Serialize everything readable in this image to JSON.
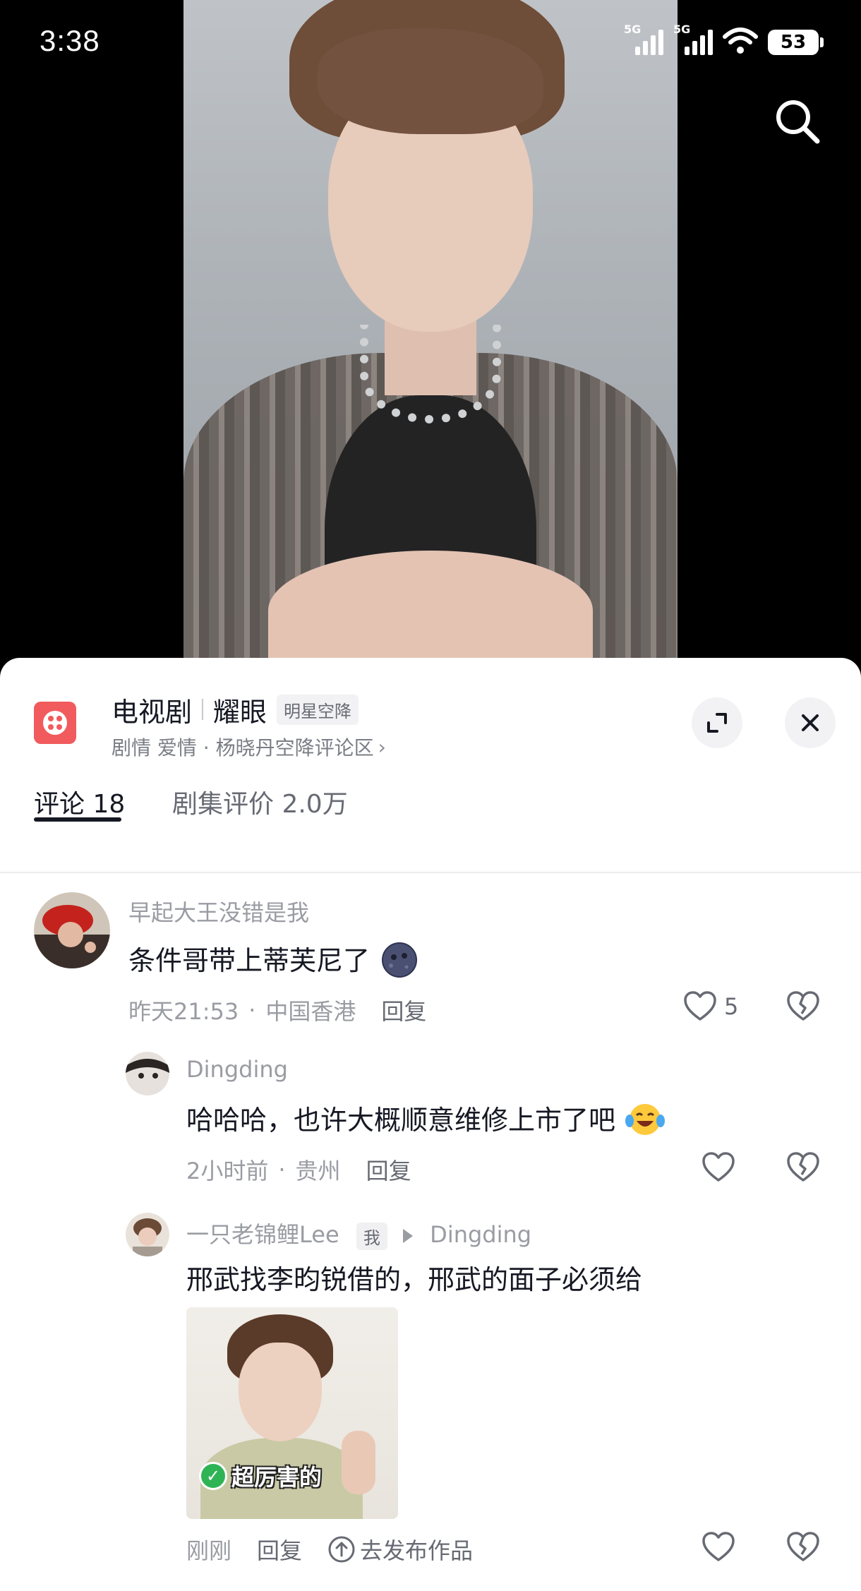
{
  "status_bar": {
    "time": "3:38",
    "signal_1_label": "5G",
    "signal_2_label": "5G",
    "battery": "53"
  },
  "video": {
    "search_icon": "search-icon"
  },
  "sheet_header": {
    "category": "电视剧",
    "show_title": "耀眼",
    "tag": "明星空降",
    "subtitle": "剧情 爱情 · 杨晓丹空降评论区",
    "subtitle_chevron": "›",
    "expand_icon": "expand-icon",
    "close_icon": "close-icon"
  },
  "tabs": [
    {
      "label": "评论 18",
      "active": true
    },
    {
      "label": "剧集评价 2.0万",
      "active": false
    }
  ],
  "comments": [
    {
      "user": "早起大王没错是我",
      "text": "条件哥带上蒂芙尼了",
      "time": "昨天21:53",
      "location": "中国香港",
      "reply_label": "回复",
      "likes": "5"
    },
    {
      "user": "Dingding",
      "text": "哈哈哈，也许大概顺意维修上市了吧",
      "time": "2小时前",
      "location": "贵州",
      "reply_label": "回复"
    },
    {
      "user": "一只老锦鲤Lee",
      "self_tag": "我",
      "reply_to": "Dingding",
      "text": "邢武找李昀锐借的，邢武的面子必须给",
      "image_caption": "超厉害的",
      "time": "刚刚",
      "reply_label": "回复",
      "publish_label": "去发布作品"
    }
  ]
}
